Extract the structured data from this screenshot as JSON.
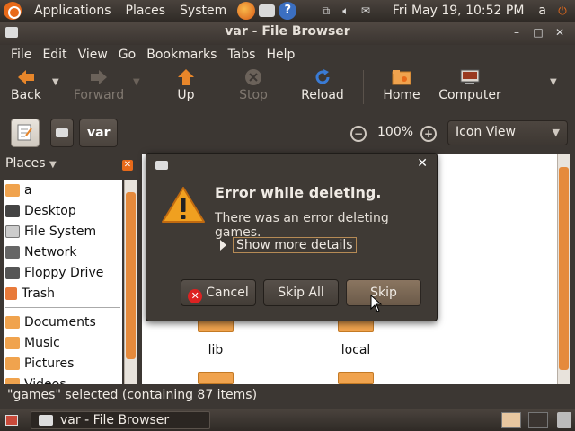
{
  "top_panel": {
    "menus": [
      "Applications",
      "Places",
      "System"
    ],
    "clock": "Fri May 19, 10:52 PM",
    "user": "a"
  },
  "window": {
    "title": "var - File Browser",
    "menubar": [
      "File",
      "Edit",
      "View",
      "Go",
      "Bookmarks",
      "Tabs",
      "Help"
    ],
    "toolbar": {
      "back": "Back",
      "forward": "Forward",
      "up": "Up",
      "stop": "Stop",
      "reload": "Reload",
      "home": "Home",
      "computer": "Computer"
    },
    "location": {
      "path_button": "var",
      "zoom": "100%",
      "view_mode": "Icon View"
    },
    "sidebar": {
      "header": "Places",
      "items": [
        {
          "label": "a",
          "icon": "home-folder-icon"
        },
        {
          "label": "Desktop",
          "icon": "desktop-icon"
        },
        {
          "label": "File System",
          "icon": "drive-icon"
        },
        {
          "label": "Network",
          "icon": "network-icon"
        },
        {
          "label": "Floppy Drive",
          "icon": "floppy-icon"
        },
        {
          "label": "Trash",
          "icon": "trash-icon"
        }
      ],
      "bookmarks": [
        {
          "label": "Documents",
          "icon": "folder-icon"
        },
        {
          "label": "Music",
          "icon": "folder-icon"
        },
        {
          "label": "Pictures",
          "icon": "folder-icon"
        },
        {
          "label": "Videos",
          "icon": "folder-icon"
        }
      ]
    },
    "content": {
      "folders": [
        "lib",
        "local"
      ]
    },
    "statusbar": "\"games\" selected (containing 87 items)"
  },
  "dialog": {
    "heading": "Error while deleting.",
    "message": "There was an error deleting games.",
    "expander": "Show more details",
    "buttons": {
      "cancel": "Cancel",
      "skip_all": "Skip All",
      "skip": "Skip"
    }
  },
  "bottom_panel": {
    "task": "var - File Browser"
  },
  "colors": {
    "accent": "#e86a1a",
    "panel": "#3b3530"
  }
}
